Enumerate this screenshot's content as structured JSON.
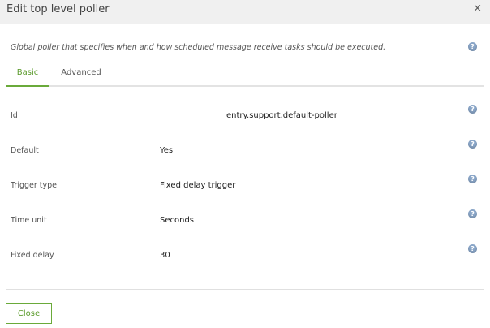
{
  "dialog": {
    "title": "Edit top level poller",
    "close_icon": "×",
    "description": "Global poller that specifies when and how scheduled message receive tasks should be executed."
  },
  "help_icon": "?",
  "tabs": [
    {
      "label": "Basic",
      "active": true
    },
    {
      "label": "Advanced",
      "active": false
    }
  ],
  "fields": [
    {
      "label": "Id",
      "value": "entry.support.default-poller"
    },
    {
      "label": "Default",
      "value": "Yes"
    },
    {
      "label": "Trigger type",
      "value": "Fixed delay trigger"
    },
    {
      "label": "Time unit",
      "value": "Seconds"
    },
    {
      "label": "Fixed delay",
      "value": "30"
    }
  ],
  "footer": {
    "close_label": "Close"
  },
  "colors": {
    "accent": "#6aaa3a",
    "help_icon": "#8aa6c8"
  }
}
